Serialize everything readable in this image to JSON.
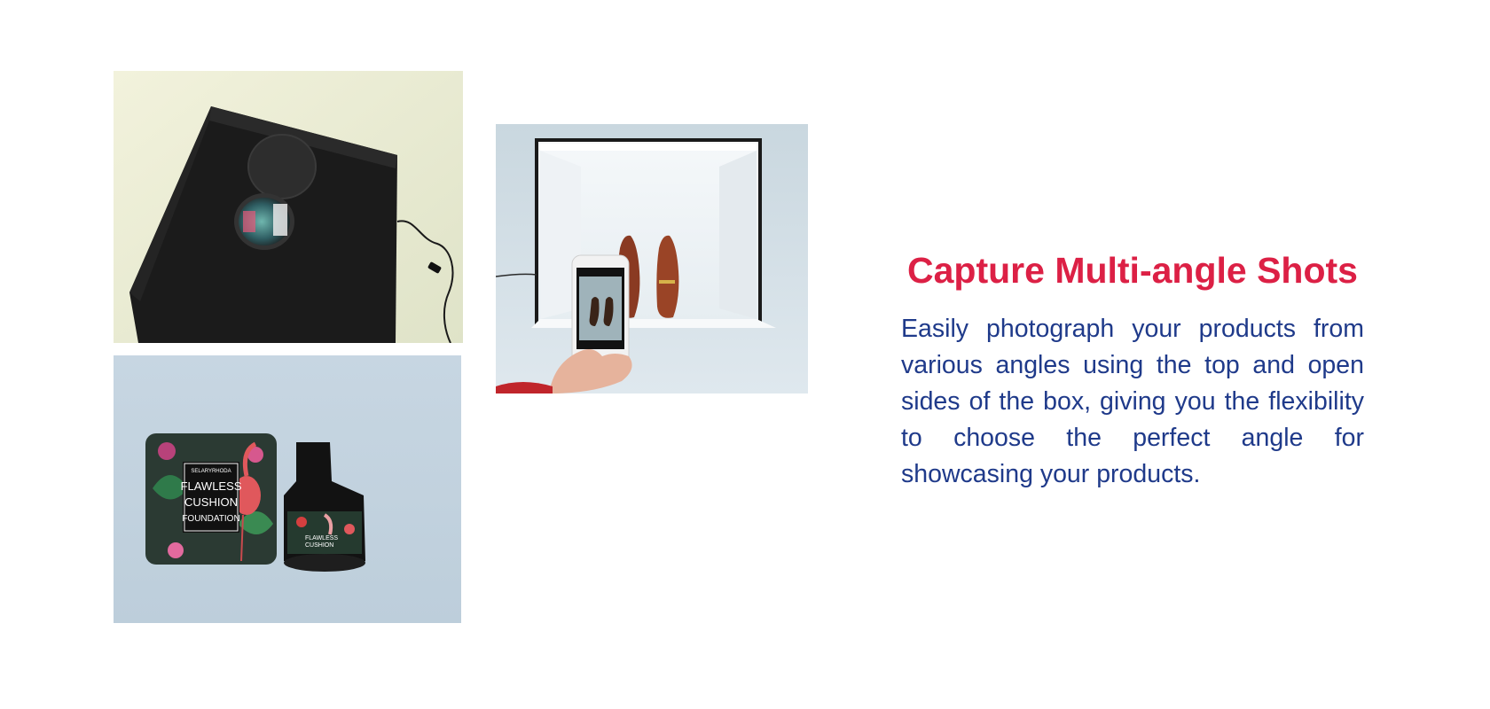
{
  "feature": {
    "title": "Capture Multi-angle Shots",
    "description": "Easily photograph your products from various angles using the top and open sides of the box, giving you the flexibility to choose the perfect angle for showcasing your products."
  },
  "product_label": {
    "brand": "SELARYRHODA",
    "line1": "FLAWLESS",
    "line2": "CUSHION",
    "line3": "FOUNDATION"
  },
  "colors": {
    "accent": "#dc2045",
    "body": "#1f3a8a"
  },
  "images": [
    {
      "name": "photo-box-top-view",
      "depicts": "black light box with circular top opening"
    },
    {
      "name": "photo-phone-shooting",
      "depicts": "hand holding phone photographing shoes inside lit box"
    },
    {
      "name": "photo-cushion-products",
      "depicts": "flamingo-pattern cushion foundation products"
    }
  ]
}
